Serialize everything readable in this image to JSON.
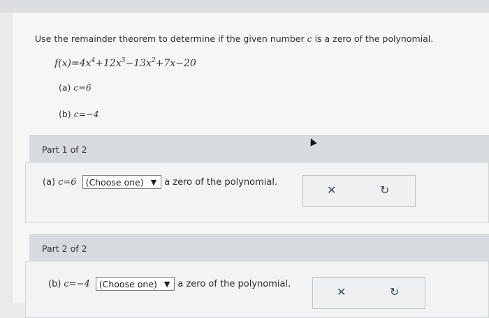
{
  "question": {
    "prompt_pre": "Use the remainder theorem to determine if the given number ",
    "prompt_var": "c",
    "prompt_post": " is a zero of the polynomial.",
    "equation": "f(x)=4x⁴+12x³−13x²+7x−20",
    "item_a_label": "(a)",
    "item_a_value": "c=6",
    "item_b_label": "(b)",
    "item_b_value": "c=−4"
  },
  "part1": {
    "header": "Part 1 of 2",
    "label": "(a)",
    "math": "c=6",
    "select_value": "(Choose one)",
    "suffix": "a zero of the polynomial.",
    "clear_icon": "close-icon",
    "undo_icon": "undo-icon"
  },
  "part2": {
    "header": "Part 2 of 2",
    "label": "(b)",
    "math": "c=−4",
    "select_value": "(Choose one)",
    "suffix": "a zero of the polynomial.",
    "clear_icon": "close-icon",
    "undo_icon": "undo-icon"
  }
}
